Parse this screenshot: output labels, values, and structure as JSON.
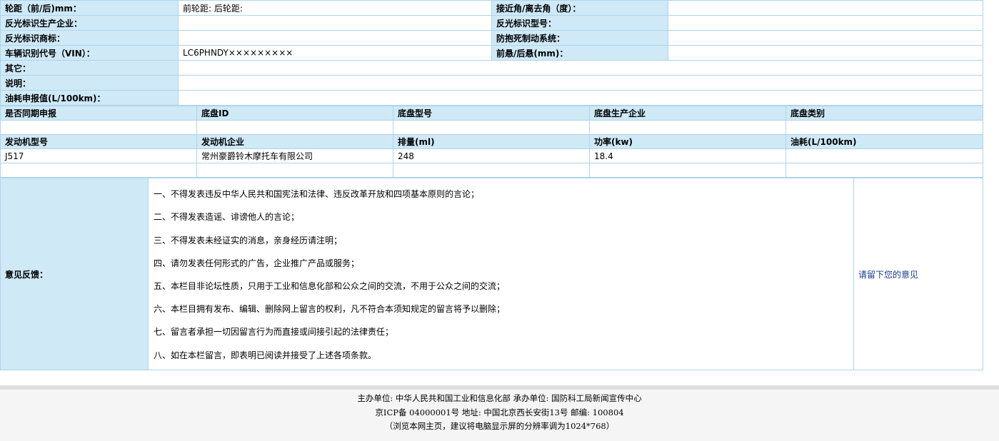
{
  "spec_rows": [
    {
      "label": "轮距（前/后)mm：",
      "value": "前轮距: 后轮距:",
      "label2": "接近角/离去角（度）：",
      "value2": ""
    },
    {
      "label": "反光标识生产企业：",
      "value": "",
      "label2": "反光标识型号：",
      "value2": ""
    },
    {
      "label": "反光标识商标：",
      "value": "",
      "label2": "防抱死制动系统：",
      "value2": ""
    },
    {
      "label": "车辆识别代号（VIN）：",
      "value": "LC6PHNDY×××××××××",
      "label2": "前悬/后悬(mm)：",
      "value2": ""
    }
  ],
  "wide_rows": [
    {
      "label": "其它：",
      "value": ""
    },
    {
      "label": "说明：",
      "value": ""
    },
    {
      "label": "油耗申报值(L/100km)：",
      "value": ""
    }
  ],
  "chassis": {
    "headers": [
      "是否同期申报",
      "底盘ID",
      "底盘型号",
      "底盘生产企业",
      "底盘类别"
    ],
    "row": [
      "",
      "",
      "",
      "",
      ""
    ]
  },
  "engine": {
    "headers": [
      "发动机型号",
      "发动机企业",
      "排量(ml)",
      "功率(kw)",
      "油耗(L/100km)"
    ],
    "rows": [
      [
        "J517",
        "常州豪爵铃木摩托车有限公司",
        "248",
        "18.4",
        ""
      ],
      [
        "",
        "",
        "",
        "",
        ""
      ]
    ]
  },
  "feedback": {
    "label": "意见反馈：",
    "terms": [
      "一、不得发表违反中华人民共和国宪法和法律、违反改革开放和四项基本原则的言论；",
      "二、不得发表造谣、诽谤他人的言论；",
      "三、不得发表未经证实的消息，亲身经历请注明；",
      "四、请勿发表任何形式的广告，企业推广产品或服务；",
      "五、本栏目非论坛性质，只用于工业和信息化部和公众之间的交流，不用于公众之间的交流；",
      "六、本栏目拥有发布、编辑、删除网上留言的权利，凡不符合本须知规定的留言将予以删除；",
      "七、留言者承担一切因留言行为而直接或间接引起的法律责任；",
      "八、如在本栏留言，即表明已阅读并接受了上述各项条款。"
    ],
    "link": "请留下您的意见"
  },
  "footer": {
    "line1": "主办单位: 中华人民共和国工业和信息化部 承办单位: 国防科工局新闻宣传中心",
    "line2": "京ICP备 04000001号 地址: 中国北京西长安街13号 邮编: 100804",
    "line3": "（浏览本网主页，建议将电脑显示屏的分辨率调为1024*768）"
  }
}
